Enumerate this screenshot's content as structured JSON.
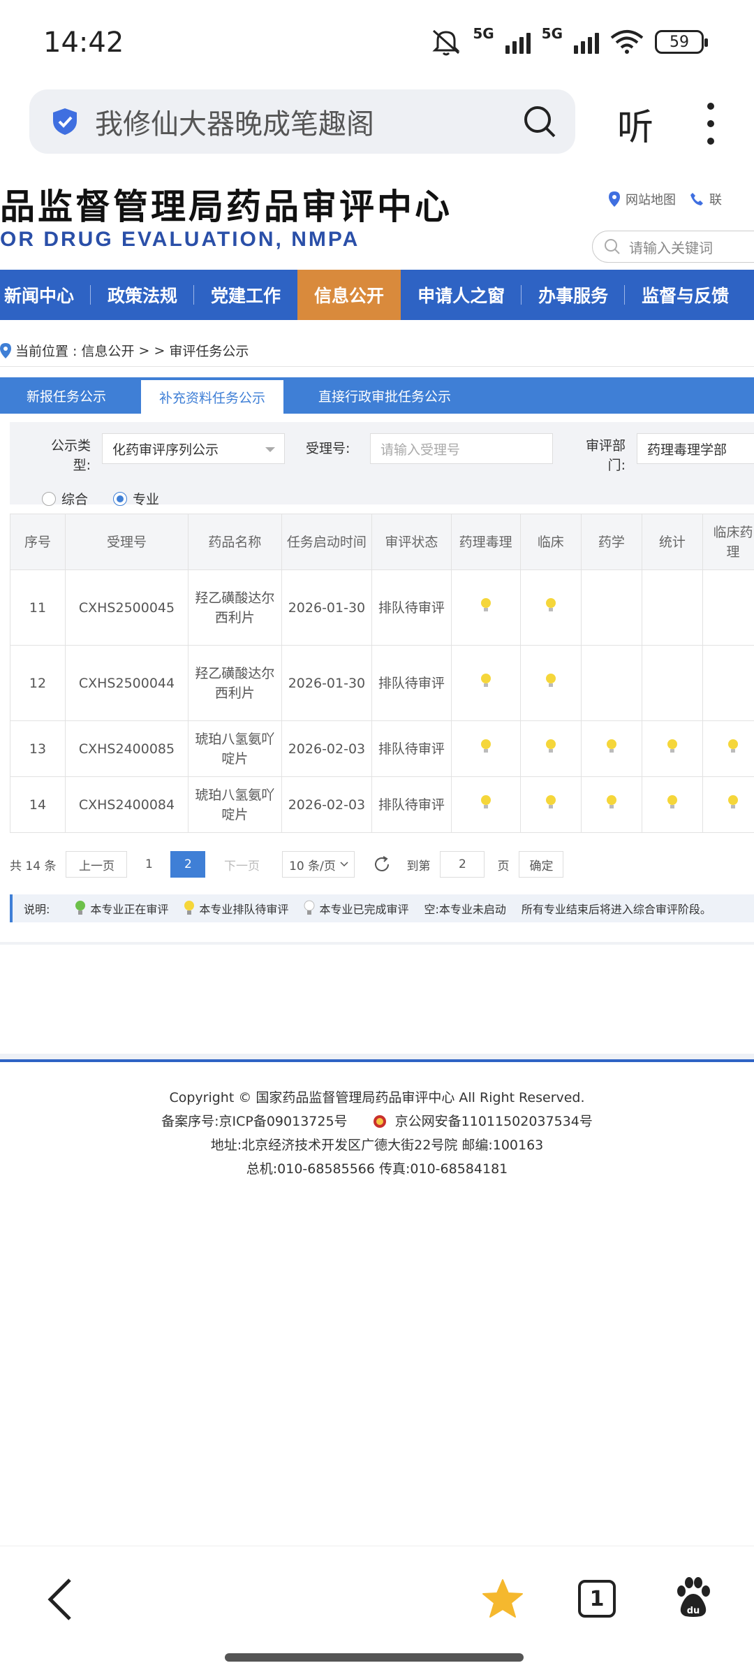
{
  "status": {
    "time": "14:42",
    "net1": "5G",
    "net2": "5G",
    "battery": "59"
  },
  "browser": {
    "query": "我修仙大器晚成笔趣阁",
    "listen_label": "听"
  },
  "site": {
    "title": "品监督管理局药品审评中心",
    "subtitle": "OR DRUG EVALUATION, NMPA",
    "sitemap_label": "网站地图",
    "contact_label": "联",
    "search_placeholder": "请输入关键词"
  },
  "nav": {
    "items": [
      "新闻中心",
      "政策法规",
      "党建工作",
      "信息公开",
      "申请人之窗",
      "办事服务",
      "监督与反馈"
    ]
  },
  "breadcrumb": {
    "prefix": "当前位置 : 信息公开",
    "sep": "> >",
    "current": "审评任务公示"
  },
  "tabs": [
    "新报任务公示",
    "补充资料任务公示",
    "直接行政审批任务公示"
  ],
  "filter": {
    "type_label": "公示类型:",
    "type_value": "化药审评序列公示",
    "accept_label": "受理号:",
    "accept_placeholder": "请输入受理号",
    "dept_label": "审评部门:",
    "dept_value": "药理毒理学部",
    "radio_all": "综合",
    "radio_pro": "专业"
  },
  "table": {
    "headers": [
      "序号",
      "受理号",
      "药品名称",
      "任务启动时间",
      "审评状态",
      "药理毒理",
      "临床",
      "药学",
      "统计",
      "临床药理"
    ],
    "rows": [
      {
        "no": "11",
        "id": "CXHS2500045",
        "name": "羟乙磺酸达尔西利片",
        "date": "2026-01-30",
        "status": "排队待审评",
        "marks": [
          true,
          true,
          false,
          false,
          false
        ]
      },
      {
        "no": "12",
        "id": "CXHS2500044",
        "name": "羟乙磺酸达尔西利片",
        "date": "2026-01-30",
        "status": "排队待审评",
        "marks": [
          true,
          true,
          false,
          false,
          false
        ]
      },
      {
        "no": "13",
        "id": "CXHS2400085",
        "name": "琥珀八氢氨吖啶片",
        "date": "2026-02-03",
        "status": "排队待审评",
        "marks": [
          true,
          true,
          true,
          true,
          true
        ]
      },
      {
        "no": "14",
        "id": "CXHS2400084",
        "name": "琥珀八氢氨吖啶片",
        "date": "2026-02-03",
        "status": "排队待审评",
        "marks": [
          true,
          true,
          true,
          true,
          true
        ]
      }
    ]
  },
  "pager": {
    "total": "共 14 条",
    "prev": "上一页",
    "p1": "1",
    "p2": "2",
    "next": "下一页",
    "size": "10 条/页",
    "goto": "到第",
    "goto_value": "2",
    "page_unit": "页",
    "confirm": "确定"
  },
  "legend": {
    "title": "说明:",
    "green": "本专业正在审评",
    "yellow": "本专业排队待审评",
    "white": "本专业已完成审评",
    "empty": "空:本专业未启动",
    "note": "所有专业结束后将进入综合审评阶段。"
  },
  "footer": {
    "copyright": "Copyright © 国家药品监督管理局药品审评中心    All Right Reserved.",
    "icp": "备案序号:京ICP备09013725号",
    "police": "京公网安备11011502037534号",
    "address": "地址:北京经济技术开发区广德大街22号院      邮编:100163",
    "phone": "总机:010-68585566      传真:010-68584181"
  },
  "bottom": {
    "tab_count": "1"
  },
  "colors": {
    "nav": "#2e63c4",
    "active_nav": "#d98a3c",
    "tab_bar": "#3f7fd6",
    "bulb_yellow": "#f5d63a",
    "bulb_green": "#6cc04a"
  }
}
